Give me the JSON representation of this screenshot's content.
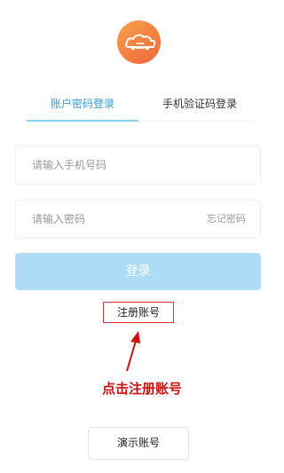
{
  "colors": {
    "accent": "#2f9bd9",
    "login_button": "#aedcf6",
    "logo_start": "#f7a14a",
    "logo_end": "#f0663a",
    "highlight_red": "#d9333a",
    "annotation_red": "#cc1111"
  },
  "logo": {
    "icon": "car-cloud-icon"
  },
  "tabs": [
    {
      "label": "账户密码登录",
      "active": true
    },
    {
      "label": "手机验证码登录",
      "active": false
    }
  ],
  "form": {
    "phone_placeholder": "请输入手机号码",
    "password_placeholder": "请输入密码",
    "forgot_label": "忘记密码",
    "login_label": "登录"
  },
  "register_label": "注册账号",
  "annotation": {
    "text": "点击注册账号",
    "icon": "arrow-up-icon"
  },
  "demo_label": "演示账号"
}
